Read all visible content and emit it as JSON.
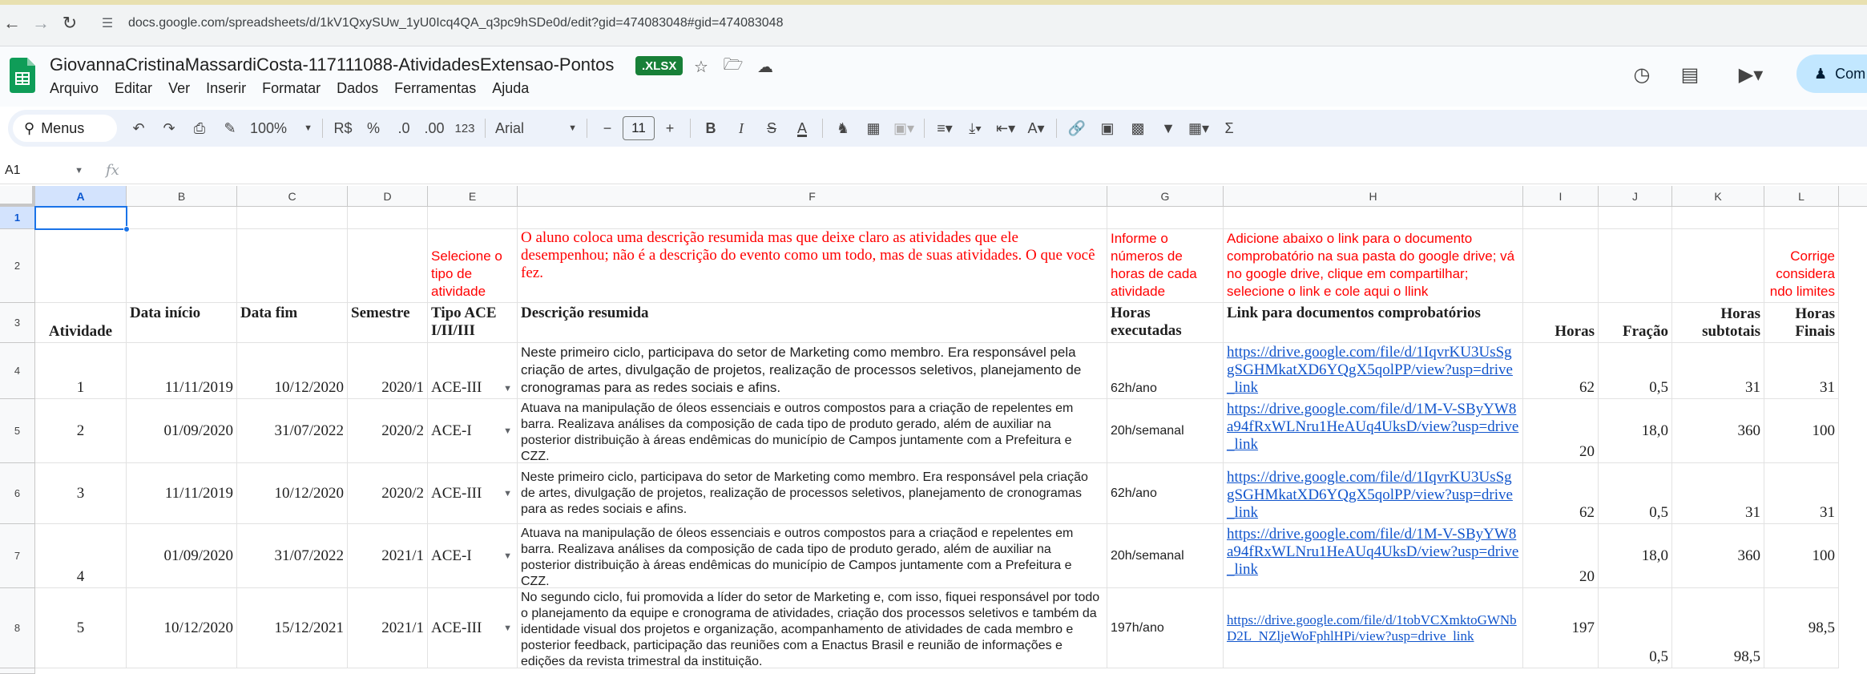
{
  "browser": {
    "url": "docs.google.com/spreadsheets/d/1kV1QxySUw_1yU0Icq4QA_q3pc9hSDe0d/edit?gid=474083048#gid=474083048"
  },
  "doc": {
    "title": "GiovannaCristinaMassardiCosta-117111088-AtividadesExtensao-Pontos",
    "badge": ".XLSX",
    "share_label": "Com"
  },
  "menu": [
    "Arquivo",
    "Editar",
    "Ver",
    "Inserir",
    "Formatar",
    "Dados",
    "Ferramentas",
    "Ajuda"
  ],
  "toolbar": {
    "menus_label": "Menus",
    "zoom": "100%",
    "currency": "R$",
    "percent": "%",
    "dec_decrease": ".0",
    "dec_increase": ".00",
    "format_123": "123",
    "font": "Arial",
    "font_size": "11"
  },
  "formula_bar": {
    "name_box": "A1",
    "fx": "fx"
  },
  "columns": [
    "A",
    "B",
    "C",
    "D",
    "E",
    "F",
    "G",
    "H",
    "I",
    "J",
    "K",
    "L"
  ],
  "rows_numbers": [
    "1",
    "2",
    "3",
    "4",
    "5",
    "6",
    "7",
    "8"
  ],
  "row2": {
    "E": "Selecione o tipo de atividade",
    "F": "O aluno coloca uma descrição resumida mas que deixe claro as atividades que ele desempenhou; não é a descrição do evento como um todo, mas de suas atividades. O que você fez.",
    "G": "Informe o números de horas de cada atividade",
    "H": "Adicione abaixo o link para o documento comprobatório na sua pasta do google drive; vá no google drive, clique em compartilhar; selecione o link e cole aqui o llink",
    "L": "Corrige considera ndo limites"
  },
  "header": {
    "A": "Atividade",
    "B": "Data início",
    "C": "Data fim",
    "D": "Semestre",
    "E": "Tipo ACE I/II/III",
    "F": "Descrição resumida",
    "G": "Horas executadas",
    "H": "Link para documentos comprobatórios",
    "I": "Horas",
    "J": "Fração",
    "K": "Horas subtotais",
    "L": "Horas Finais"
  },
  "rows": [
    {
      "A": "1",
      "B": "11/11/2019",
      "C": "10/12/2020",
      "D": "2020/1",
      "E": "ACE-III",
      "F": "Neste primeiro ciclo, participava do setor de Marketing como membro. Era responsável pela criação de artes, divulgação de projetos, realização de processos seletivos, planejamento de cronogramas para as redes sociais e afins.",
      "G": "62h/ano",
      "H": "https://drive.google.com/file/d/1IqvrKU3UsSggSGHMkatXD6YQgX5qolPP/view?usp=drive_link",
      "I": "62",
      "J": "0,5",
      "K": "31",
      "L": "31"
    },
    {
      "A": "2",
      "B": "01/09/2020",
      "C": "31/07/2022",
      "D": "2020/2",
      "E": "ACE-I",
      "F": "Atuava na manipulação de óleos essenciais e outros compostos para a criação de repelentes em barra. Realizava análises da composição de cada tipo de produto gerado, além de auxiliar na posterior distribuição à áreas endêmicas do município de Campos juntamente com a Prefeitura e CZZ.",
      "G": "20h/semanal",
      "H": "https://drive.google.com/file/d/1M-V-SByYW8a94fRxWLNru1HeAUq4UksD/view?usp=drive_link",
      "I": "20",
      "J": "18,0",
      "K": "360",
      "L": "100"
    },
    {
      "A": "3",
      "B": "11/11/2019",
      "C": "10/12/2020",
      "D": "2020/2",
      "E": "ACE-III",
      "F": "Neste primeiro ciclo, participava do setor de Marketing como membro. Era responsável pela criação de artes, divulgação de projetos, realização de processos seletivos, planejamento de cronogramas para as redes sociais e afins.",
      "G": "62h/ano",
      "H": "https://drive.google.com/file/d/1IqvrKU3UsSggSGHMkatXD6YQgX5qolPP/view?usp=drive_link",
      "I": "62",
      "J": "0,5",
      "K": "31",
      "L": "31"
    },
    {
      "A": "4",
      "B": "01/09/2020",
      "C": "31/07/2022",
      "D": "2021/1",
      "E": "ACE-I",
      "F": "Atuava na manipulação de óleos essenciais e outros compostos para a criaçãod e repelentes em barra. Realizava análises da composição de cada tipo de produto gerado, além de auxiliar na posterior distribuição à áreas endêmicas do município de Campos juntamente com a Prefeitura e CZZ.",
      "G": "20h/semanal",
      "H": "https://drive.google.com/file/d/1M-V-SByYW8a94fRxWLNru1HeAUq4UksD/view?usp=drive_link",
      "I": "20",
      "J": "18,0",
      "K": "360",
      "L": "100"
    },
    {
      "A": "5",
      "B": "10/12/2020",
      "C": "15/12/2021",
      "D": "2021/1",
      "E": "ACE-III",
      "F": "No segundo ciclo, fui promovida a líder do setor de Marketing e, com isso, fiquei responsável por todo o planejamento da equipe e cronograma de atividades, criação dos processos seletivos e também da identidade visual dos projetos e organização, acompanhamento de atividades de cada membro e posterior feedback, participação das reuniões com a Enactus Brasil e reunião de informações e edições da revista trimestral da instituição.",
      "G": "197h/ano",
      "H": "https://drive.google.com/file/d/1tobVCXmktoGWNbD2L_NZljeWoFphlHPi/view?usp=drive_link",
      "I": "197",
      "J": "0,5",
      "K": "98,5",
      "L": "98,5"
    }
  ]
}
